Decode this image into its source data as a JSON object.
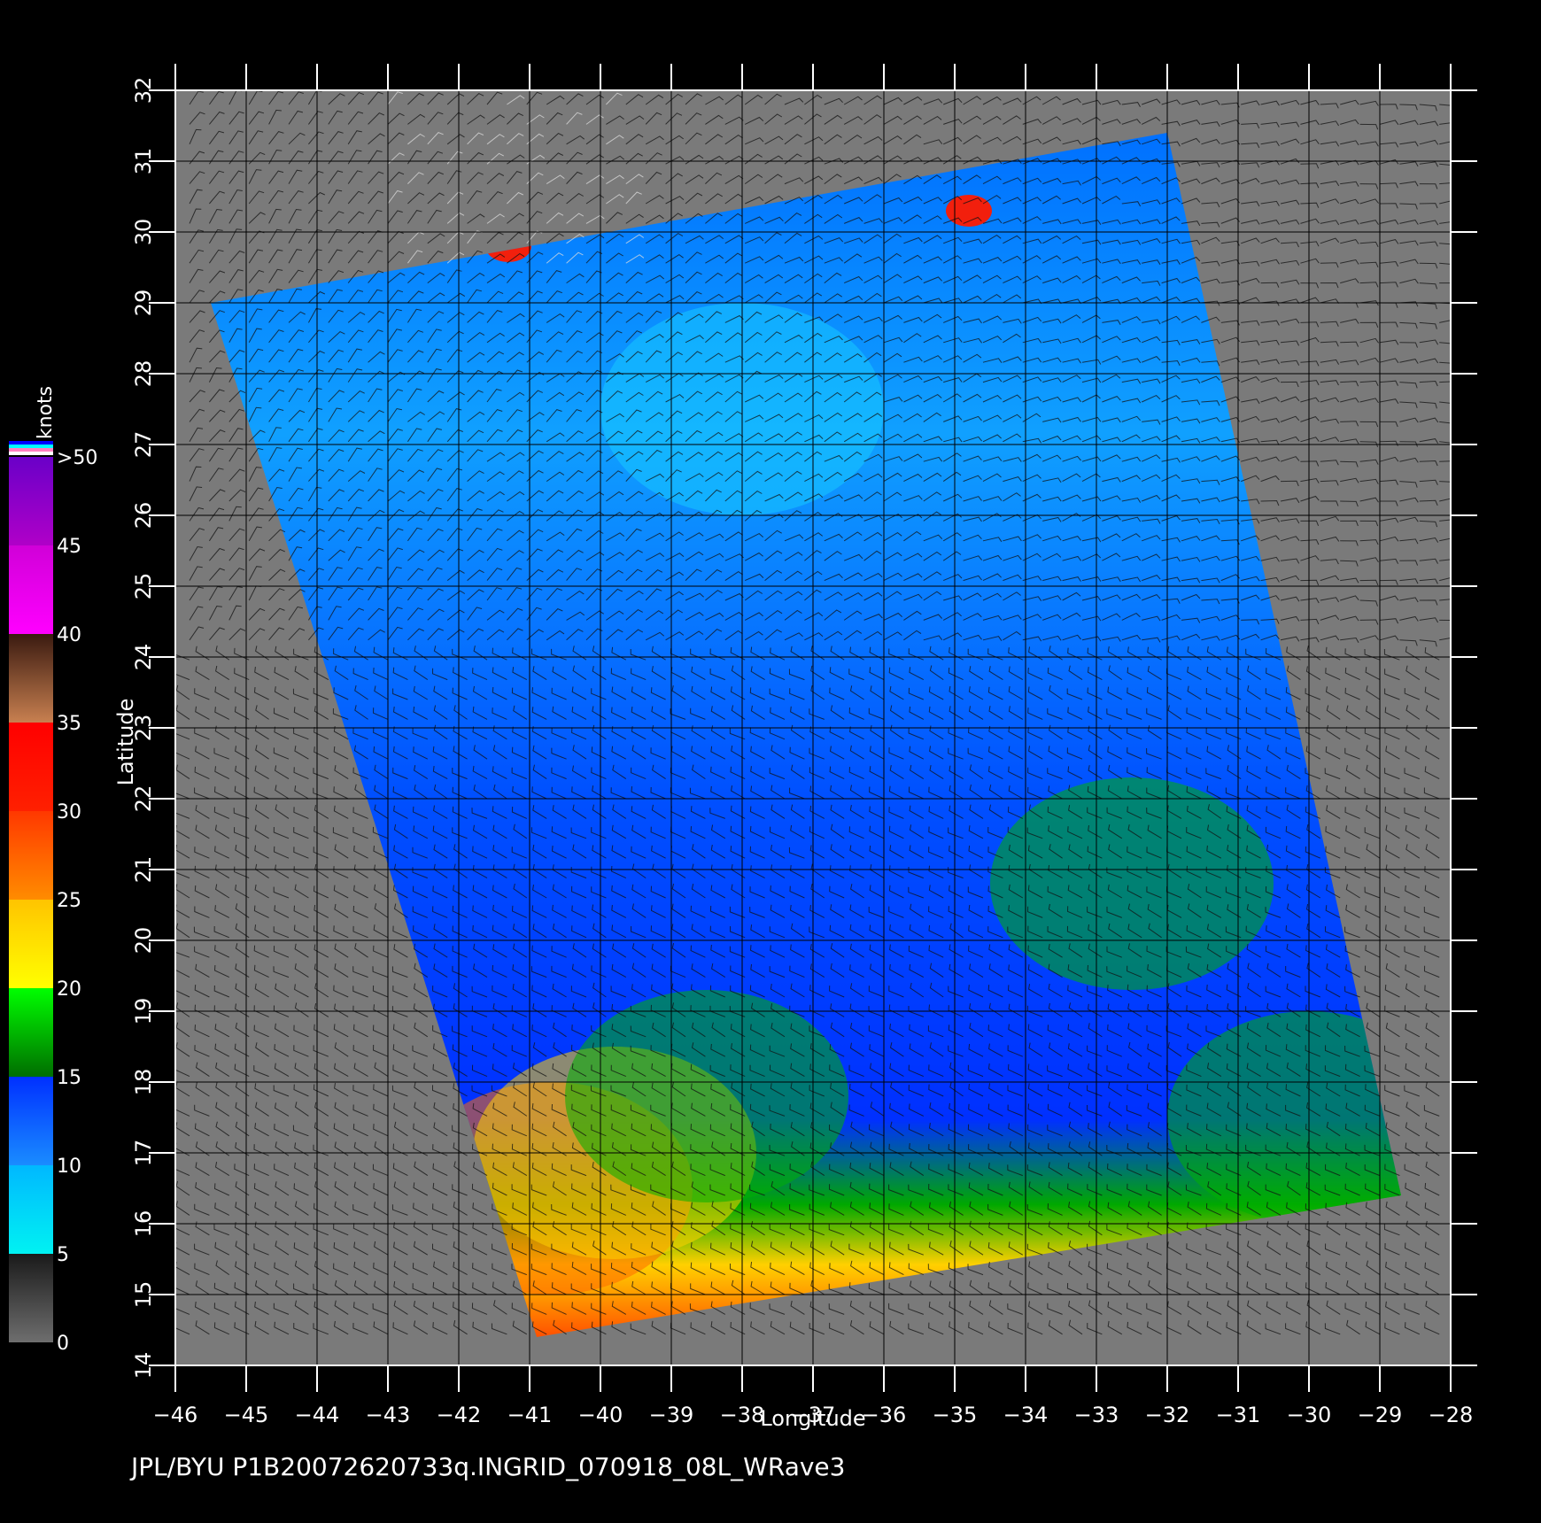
{
  "chart_data": {
    "type": "heatmap",
    "xlabel": "Longitude",
    "ylabel": "Latitude",
    "xlim": [
      -46,
      -28
    ],
    "ylim": [
      14,
      32
    ],
    "x_ticks": [
      "-46",
      "-45",
      "-44",
      "-43",
      "-42",
      "-41",
      "-40",
      "-39",
      "-38",
      "-37",
      "-36",
      "-35",
      "-34",
      "-33",
      "-32",
      "-31",
      "-30",
      "-29",
      "-28"
    ],
    "y_ticks": [
      "14",
      "15",
      "16",
      "17",
      "18",
      "19",
      "20",
      "21",
      "22",
      "23",
      "24",
      "25",
      "26",
      "27",
      "28",
      "29",
      "30",
      "31",
      "32"
    ],
    "grid": true,
    "swath_corners_lonlat": [
      [
        -45.5,
        29.0
      ],
      [
        -32.0,
        31.4
      ],
      [
        -28.7,
        16.4
      ],
      [
        -40.9,
        14.4
      ]
    ],
    "colorbar": {
      "label": "knots",
      "ticks": [
        "0",
        "5",
        "10",
        "15",
        "20",
        "25",
        "30",
        "35",
        "40",
        "45",
        ">50"
      ],
      "stops": [
        {
          "from": 0,
          "to": 5,
          "colors": [
            "#6e6e6e",
            "#1a1a1a"
          ]
        },
        {
          "from": 5,
          "to": 10,
          "colors": [
            "#00f2f2",
            "#00b8ff"
          ]
        },
        {
          "from": 10,
          "to": 15,
          "colors": [
            "#1a8cff",
            "#0030ff"
          ]
        },
        {
          "from": 15,
          "to": 20,
          "colors": [
            "#006e00",
            "#00ff00"
          ]
        },
        {
          "from": 20,
          "to": 25,
          "colors": [
            "#ffff00",
            "#ffc400"
          ]
        },
        {
          "from": 25,
          "to": 30,
          "colors": [
            "#ff8c00",
            "#ff3800"
          ]
        },
        {
          "from": 30,
          "to": 35,
          "colors": [
            "#ff2000",
            "#ff0000"
          ]
        },
        {
          "from": 35,
          "to": 40,
          "colors": [
            "#c88050",
            "#3a1a10"
          ]
        },
        {
          "from": 40,
          "to": 45,
          "colors": [
            "#ff00ff",
            "#d000d8"
          ]
        },
        {
          "from": 45,
          "to": 50,
          "colors": [
            "#b000c8",
            "#6a00c8"
          ]
        }
      ]
    },
    "wind_regions": [
      {
        "desc": "coastal high wind strip",
        "lon": -40.7,
        "lat": 16.5,
        "speed": 27
      },
      {
        "desc": "moderate band",
        "lon": -39.8,
        "lat": 17.0,
        "speed": 21
      },
      {
        "desc": "green trade-wind zone south",
        "lon": -38.5,
        "lat": 17.8,
        "speed": 16
      },
      {
        "desc": "green trade-wind zone east",
        "lon": -30.0,
        "lat": 17.5,
        "speed": 17
      },
      {
        "desc": "green patch east mid",
        "lon": -32.5,
        "lat": 20.8,
        "speed": 16
      },
      {
        "desc": "light wind north",
        "lon": -38.0,
        "lat": 27.5,
        "speed": 8
      },
      {
        "desc": "rain cell",
        "lon": -41.3,
        "lat": 29.8,
        "speed": 32
      },
      {
        "desc": "rain cell",
        "lon": -34.8,
        "lat": 30.3,
        "speed": 30
      }
    ]
  },
  "footer": "JPL/BYU  P1B20072620733q.INGRID_070918_08L_WRave3"
}
